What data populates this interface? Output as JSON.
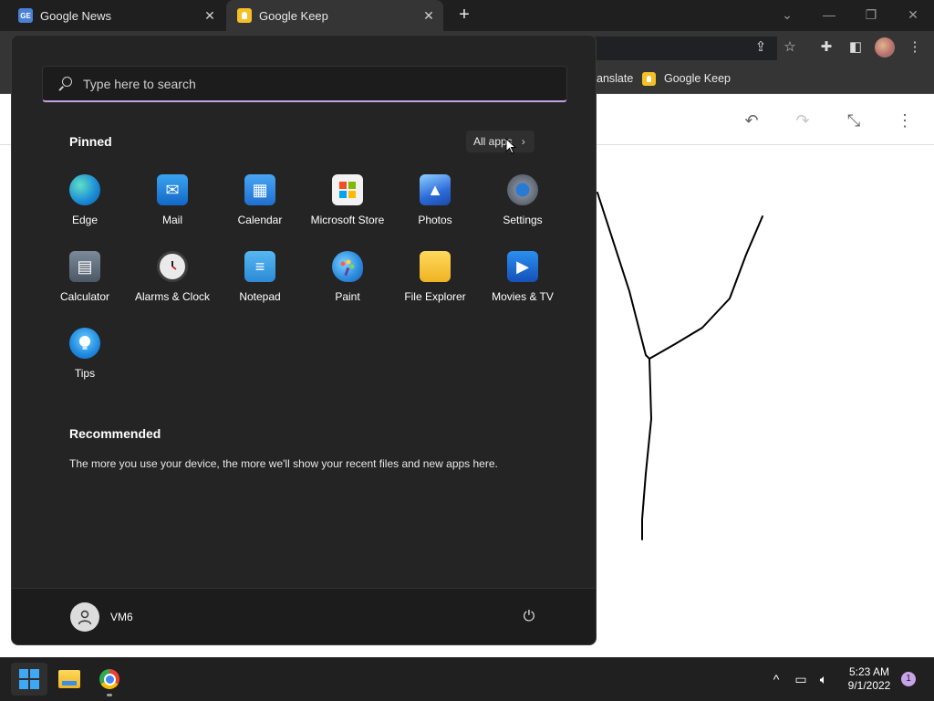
{
  "browser": {
    "tabs": [
      {
        "label": "Google News",
        "favicon": "google-news-icon"
      },
      {
        "label": "Google Keep",
        "favicon": "google-keep-icon"
      }
    ],
    "new_tab_glyph": "+",
    "bookmarks": [
      {
        "label": "anslate"
      },
      {
        "label": "Google Keep"
      }
    ]
  },
  "start_menu": {
    "search_placeholder": "Type here to search",
    "pinned_title": "Pinned",
    "all_apps_label": "All apps",
    "pinned": [
      {
        "label": "Edge",
        "icon": "edge-icon"
      },
      {
        "label": "Mail",
        "icon": "mail-icon"
      },
      {
        "label": "Calendar",
        "icon": "calendar-icon"
      },
      {
        "label": "Microsoft Store",
        "icon": "store-icon"
      },
      {
        "label": "Photos",
        "icon": "photos-icon"
      },
      {
        "label": "Settings",
        "icon": "settings-icon"
      },
      {
        "label": "Calculator",
        "icon": "calculator-icon"
      },
      {
        "label": "Alarms & Clock",
        "icon": "clock-icon"
      },
      {
        "label": "Notepad",
        "icon": "notepad-icon"
      },
      {
        "label": "Paint",
        "icon": "paint-icon"
      },
      {
        "label": "File Explorer",
        "icon": "folder-icon"
      },
      {
        "label": "Movies & TV",
        "icon": "movies-icon"
      },
      {
        "label": "Tips",
        "icon": "tips-icon"
      }
    ],
    "recommended_title": "Recommended",
    "recommended_text": "The more you use your device, the more we'll show your recent files and new apps here.",
    "user_name": "VM6"
  },
  "taskbar": {
    "time": "5:23 AM",
    "date": "9/1/2022",
    "notification_count": "1"
  },
  "colors": {
    "start_bg": "#242424",
    "taskbar_bg": "#202020",
    "accent": "#c8a0e0",
    "keep_yellow": "#f6bf26"
  }
}
